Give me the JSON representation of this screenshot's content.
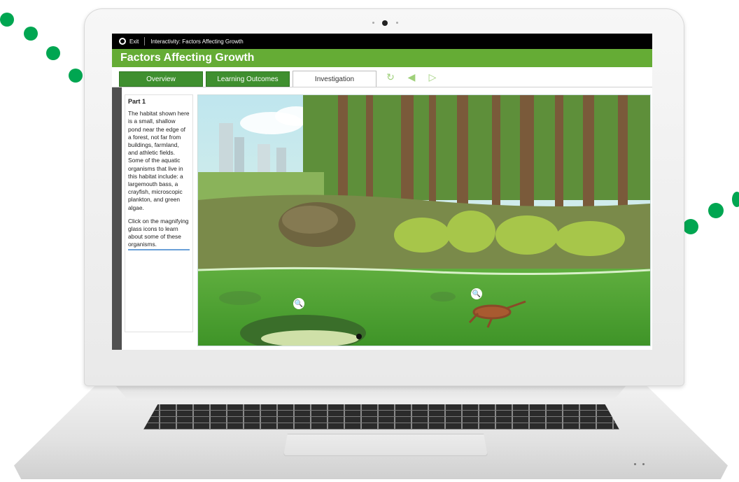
{
  "app": {
    "exit_label": "Exit",
    "breadcrumb": "Interactivity: Factors Affecting Growth",
    "title": "Factors Affecting Growth"
  },
  "tabs": [
    {
      "label": "Overview"
    },
    {
      "label": "Learning Outcomes"
    },
    {
      "label": "Investigation"
    }
  ],
  "active_tab": "Investigation",
  "nav_icons": [
    "refresh-icon",
    "previous-icon",
    "next-icon"
  ],
  "panel": {
    "heading": "Part 1",
    "paragraph1": "The habitat shown here is a small, shallow pond near the edge of a forest, not far from buildings, farmland, and athletic fields. Some of the aquatic organisms that live in this habitat include: a largemouth bass, a crayfish, microscopic plankton, and green algae.",
    "paragraph2": "Click on the magnifying glass icons to learn about some of these organisms."
  },
  "colors": {
    "accent": "#65ac35",
    "tab_dark": "#3f8f2f",
    "decor_dots": "#00a651"
  }
}
